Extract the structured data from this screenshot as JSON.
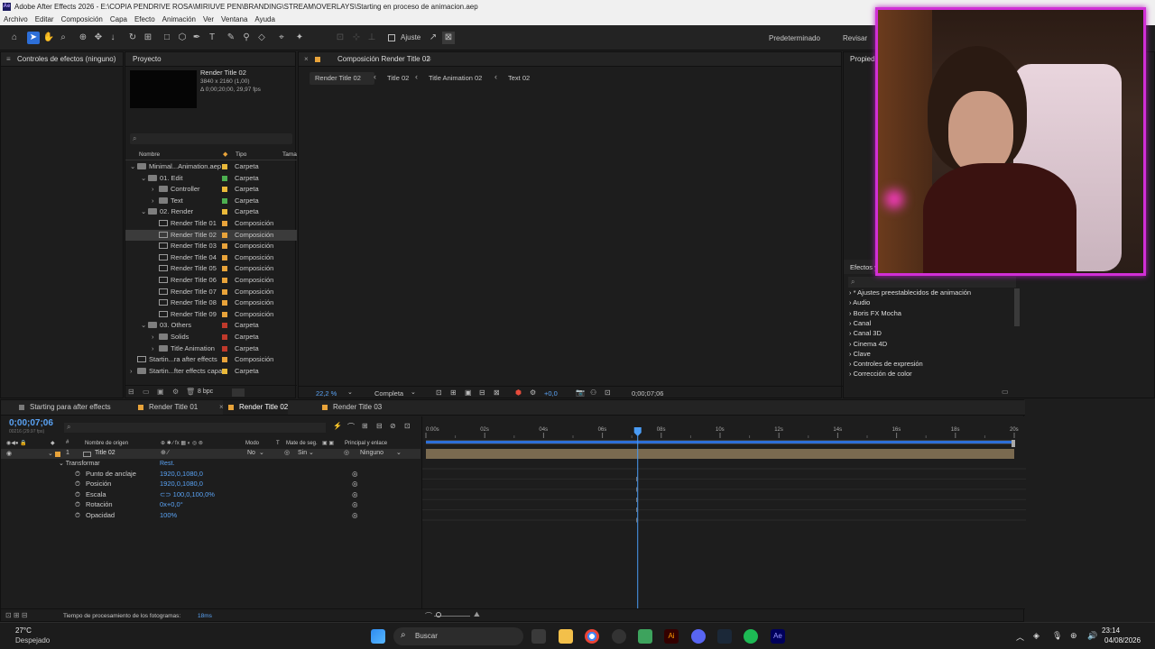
{
  "app": {
    "title": "Adobe After Effects 2026 - E:\\COPIA PENDRIVE ROSA\\MIRIUVE PEN\\BRANDING\\STREAM\\OVERLAYS\\Starting en proceso de animacion.aep",
    "logo": "Ae"
  },
  "menu": [
    "Archivo",
    "Editar",
    "Composición",
    "Capa",
    "Efecto",
    "Animación",
    "Ver",
    "Ventana",
    "Ayuda"
  ],
  "toolbar": {
    "snap_label": "Ajuste",
    "workspace": "Predeterminado",
    "review": "Revisar"
  },
  "effects_controls": {
    "title": "Controles de efectos (ninguno)"
  },
  "project": {
    "title": "Proyecto",
    "comp_name": "Render Title 02",
    "comp_res": "3840 x 2160 (1,00)",
    "comp_dur": "Δ 0;00;20;00, 29,97 fps",
    "search_placeholder": "",
    "col_name": "Nombre",
    "col_type": "Tipo",
    "col_size": "Tama",
    "bpc": "8 bpc",
    "items": [
      {
        "name": "Minimal...Animation.aep",
        "type": "Carpeta",
        "color": "#eab93a",
        "kind": "folder",
        "depth": 0,
        "arrow": "v"
      },
      {
        "name": "01. Edit",
        "type": "Carpeta",
        "color": "#4caf50",
        "kind": "folder",
        "depth": 1,
        "arrow": "v"
      },
      {
        "name": "Controller",
        "type": "Carpeta",
        "color": "#eab93a",
        "kind": "folder",
        "depth": 2,
        "arrow": ">"
      },
      {
        "name": "Text",
        "type": "Carpeta",
        "color": "#4caf50",
        "kind": "folder",
        "depth": 2,
        "arrow": ">"
      },
      {
        "name": "02. Render",
        "type": "Carpeta",
        "color": "#eab93a",
        "kind": "folder",
        "depth": 1,
        "arrow": "v"
      },
      {
        "name": "Render Title 01",
        "type": "Composición",
        "color": "#e8a33a",
        "kind": "comp",
        "depth": 2,
        "arrow": ""
      },
      {
        "name": "Render Title 02",
        "type": "Composición",
        "color": "#e8a33a",
        "kind": "comp",
        "depth": 2,
        "arrow": "",
        "selected": true
      },
      {
        "name": "Render Title 03",
        "type": "Composición",
        "color": "#e8a33a",
        "kind": "comp",
        "depth": 2,
        "arrow": ""
      },
      {
        "name": "Render Title 04",
        "type": "Composición",
        "color": "#e8a33a",
        "kind": "comp",
        "depth": 2,
        "arrow": ""
      },
      {
        "name": "Render Title 05",
        "type": "Composición",
        "color": "#e8a33a",
        "kind": "comp",
        "depth": 2,
        "arrow": ""
      },
      {
        "name": "Render Title 06",
        "type": "Composición",
        "color": "#e8a33a",
        "kind": "comp",
        "depth": 2,
        "arrow": ""
      },
      {
        "name": "Render Title 07",
        "type": "Composición",
        "color": "#e8a33a",
        "kind": "comp",
        "depth": 2,
        "arrow": ""
      },
      {
        "name": "Render Title 08",
        "type": "Composición",
        "color": "#e8a33a",
        "kind": "comp",
        "depth": 2,
        "arrow": ""
      },
      {
        "name": "Render Title 09",
        "type": "Composición",
        "color": "#e8a33a",
        "kind": "comp",
        "depth": 2,
        "arrow": ""
      },
      {
        "name": "03. Others",
        "type": "Carpeta",
        "color": "#c0392b",
        "kind": "folder",
        "depth": 1,
        "arrow": "v"
      },
      {
        "name": "Solids",
        "type": "Carpeta",
        "color": "#c0392b",
        "kind": "folder",
        "depth": 2,
        "arrow": ">"
      },
      {
        "name": "Title Animation",
        "type": "Carpeta",
        "color": "#c0392b",
        "kind": "folder",
        "depth": 2,
        "arrow": ">"
      },
      {
        "name": "Startin...ra after effects",
        "type": "Composición",
        "color": "#e8a33a",
        "kind": "comp",
        "depth": 0,
        "arrow": ""
      },
      {
        "name": "Startin...fter effects capas",
        "type": "Carpeta",
        "color": "#eab93a",
        "kind": "folder",
        "depth": 0,
        "arrow": ">"
      }
    ]
  },
  "composition": {
    "title": "Composición Render Title 02",
    "breadcrumbs": [
      "Render Title 02",
      "Title 02",
      "Title Animation 02",
      "Text 02"
    ],
    "zoom": "22,2 %",
    "quality": "Completa",
    "exposure": "+0,0",
    "timecode": "0;00;07;06"
  },
  "effects_panel": {
    "title": "Efectos y",
    "properties_title": "Propied",
    "items": [
      "* Ajustes preestablecidos de animación",
      "Audio",
      "Boris FX Mocha",
      "Canal",
      "Canal 3D",
      "Cinema 4D",
      "Clave",
      "Controles de expresión",
      "Corrección de color"
    ]
  },
  "timeline": {
    "tabs": [
      {
        "label": "Starting para after effects",
        "color": "#7a7a7a"
      },
      {
        "label": "Render Title 01",
        "color": "#e8a33a"
      },
      {
        "label": "Render Title 02",
        "color": "#e8a33a",
        "active": true
      },
      {
        "label": "Render Title 03",
        "color": "#e8a33a"
      }
    ],
    "timecode": "0;00;07;06",
    "timecode_sub": "00216 (29.97 fps)",
    "cols": {
      "num": "#",
      "source": "Nombre de origen",
      "mode": "Modo",
      "t": "T",
      "matte": "Mate de seg.",
      "parent": "Principal y enlace"
    },
    "layer": {
      "num": "1",
      "name": "Title 02",
      "mode": "No",
      "matte": "Sin",
      "parent": "Ninguno"
    },
    "transform": "Transformar",
    "reset": "Rest.",
    "props": [
      {
        "name": "Punto de anclaje",
        "value": "1920,0,1080,0"
      },
      {
        "name": "Posición",
        "value": "1920,0,1080,0"
      },
      {
        "name": "Escala",
        "value": "100,0,100,0%"
      },
      {
        "name": "Rotación",
        "value": "0x+0,0°"
      },
      {
        "name": "Opacidad",
        "value": "100%"
      }
    ],
    "ruler": [
      "0:00s",
      "02s",
      "04s",
      "06s",
      "08s",
      "10s",
      "12s",
      "14s",
      "16s",
      "18s",
      "20s"
    ],
    "playhead_seconds": 7.2,
    "duration_seconds": 20,
    "render_time_label": "Tiempo de procesamiento de los fotogramas:",
    "render_time_value": "18ms"
  },
  "taskbar": {
    "temp": "27°C",
    "weather": "Despejado",
    "search": "Buscar",
    "time": "23:14",
    "date": "04/08/2026"
  }
}
